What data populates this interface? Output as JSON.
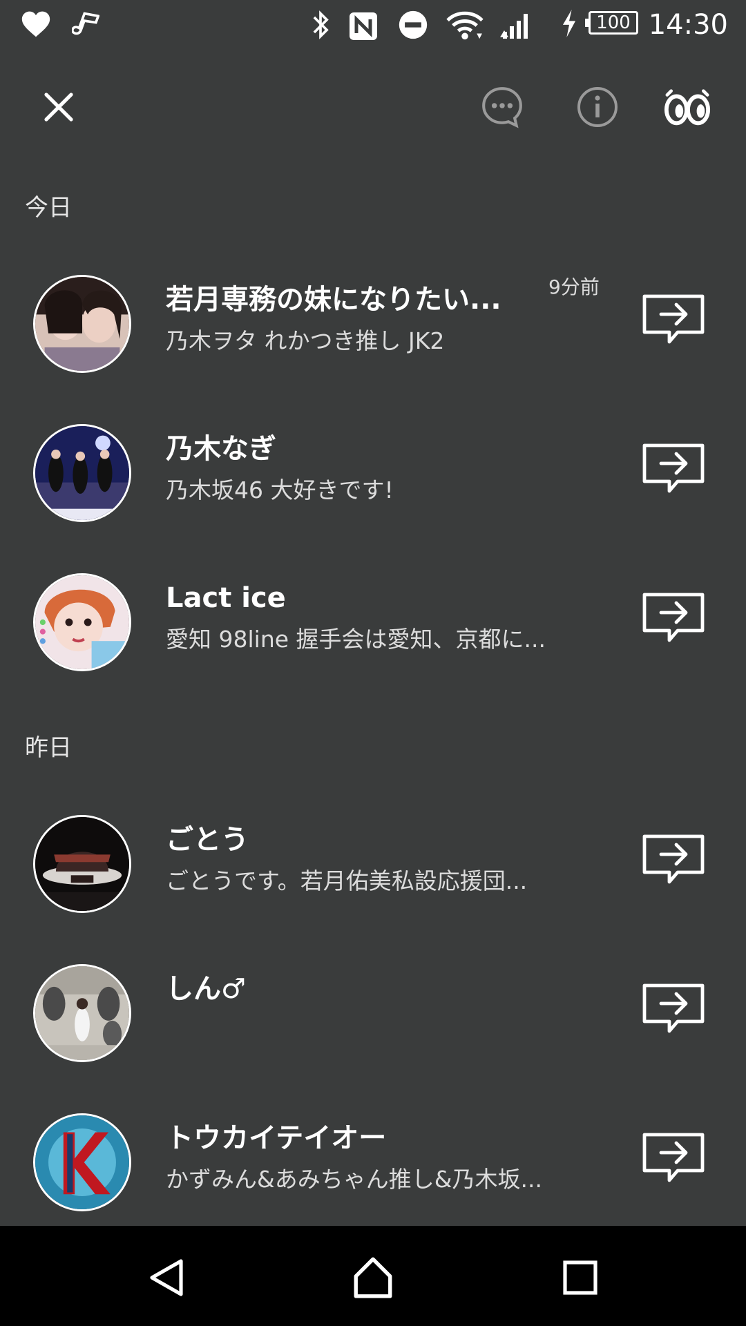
{
  "status_bar": {
    "time": "14:30",
    "battery": "100",
    "icons": [
      "heart-icon",
      "music-note-icon",
      "bluetooth-icon",
      "nfc-icon",
      "do-not-disturb-icon",
      "wifi-icon",
      "cell-signal-icon",
      "charging-icon",
      "battery-icon"
    ]
  },
  "toolbar": {
    "icons": [
      "close-icon",
      "chat-bubble-icon",
      "info-icon",
      "eyes-icon"
    ]
  },
  "sections": [
    {
      "header": "今日",
      "rows": [
        {
          "name": "若月専務の妹になりたい...",
          "sub": "乃木ヲタ れかつき推し JK2",
          "time": "9分前"
        },
        {
          "name": "乃木なぎ",
          "sub": "乃木坂46 大好きです!",
          "time": ""
        },
        {
          "name": "Lact ice",
          "sub": "愛知 98line 握手会は愛知、京都に...",
          "time": ""
        }
      ]
    },
    {
      "header": "昨日",
      "rows": [
        {
          "name": "ごとう",
          "sub": "ごとうです。若月佑美私設応援団...",
          "time": ""
        },
        {
          "name": "しん♂",
          "sub": "",
          "time": ""
        },
        {
          "name": "トウカイテイオー",
          "sub": "かずみん&あみちゃん推し&乃木坂...",
          "time": ""
        }
      ]
    }
  ],
  "nav_bar": {
    "icons": [
      "back-icon",
      "home-icon",
      "recents-icon"
    ]
  },
  "colors": {
    "background": "#3a3c3c",
    "text": "#ffffff",
    "subtext": "#dcdcdc",
    "nav_background": "#000000"
  }
}
